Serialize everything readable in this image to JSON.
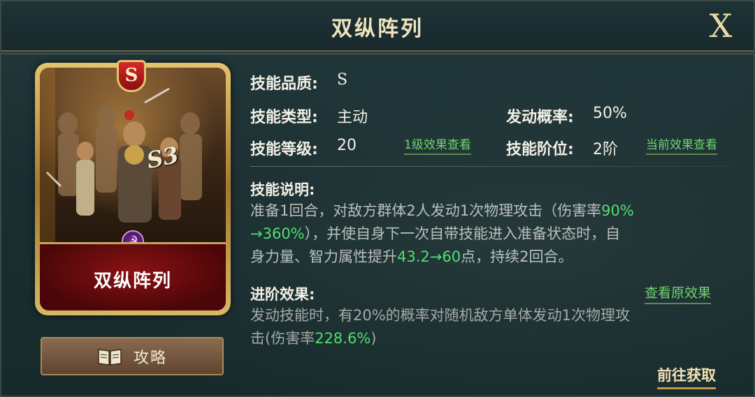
{
  "header": {
    "title": "双纵阵列",
    "close_label": "X"
  },
  "card": {
    "name": "双纵阵列",
    "grade": "S",
    "season": "S3",
    "faction_icon": "hammer-sickle-icon",
    "guide_label": "攻略"
  },
  "info": {
    "quality_label": "技能品质:",
    "quality_value": "S",
    "type_label": "技能类型:",
    "type_value": "主动",
    "rate_label": "发动概率:",
    "rate_value": "50%",
    "level_label": "技能等级:",
    "level_value": "20",
    "level_link": "1级效果查看",
    "rank_label": "技能阶位:",
    "rank_value": "2阶",
    "rank_link": "当前效果查看"
  },
  "description": {
    "label": "技能说明:",
    "text_1": "准备1回合，对敌方群体2人发动1次物理攻击（伤害率",
    "hl_1": "90%",
    "hl_2": "→360%",
    "text_2": "），并使自身下一次自带技能进入准备状态时，自",
    "text_3": "身力量、智力属性提升",
    "hl_3": "43.2→60",
    "text_4": "点，持续2回合。"
  },
  "advance": {
    "label": "进阶效果:",
    "link": "查看原效果",
    "text_1": "发动技能时，有20%的概率对随机敌方单体发动1次物理攻",
    "text_2": "击(伤害率",
    "hl_1": "228.6%",
    "text_3": ")"
  },
  "goto_label": "前往获取",
  "colors": {
    "highlight": "#4fe06b",
    "link": "#6ed56c",
    "title": "#f1e4bd"
  }
}
